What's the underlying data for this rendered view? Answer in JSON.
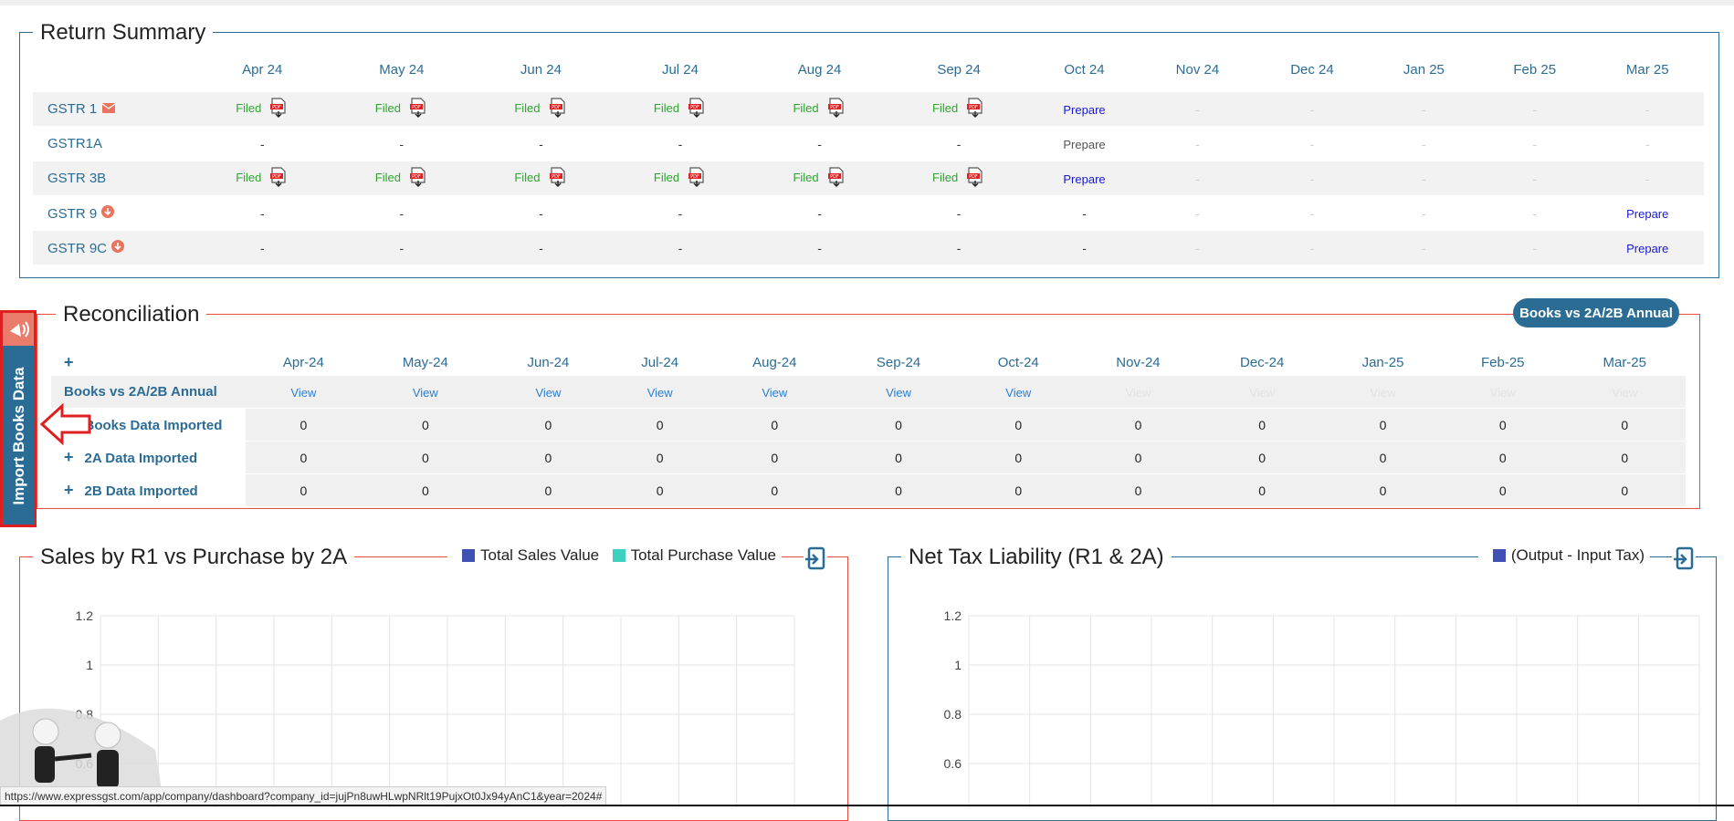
{
  "return_summary": {
    "title": "Return Summary",
    "months": [
      "Apr 24",
      "May 24",
      "Jun 24",
      "Jul 24",
      "Aug 24",
      "Sep 24",
      "Oct 24",
      "Nov 24",
      "Dec 24",
      "Jan 25",
      "Feb 25",
      "Mar 25"
    ],
    "rows": [
      {
        "name": "GSTR 1",
        "icon": "envelope-icon",
        "cells": [
          "Filed",
          "Filed",
          "Filed",
          "Filed",
          "Filed",
          "Filed",
          "Prepare",
          "-",
          "-",
          "-",
          "-",
          "-"
        ]
      },
      {
        "name": "GSTR1A",
        "icon": "",
        "cells": [
          "-",
          "-",
          "-",
          "-",
          "-",
          "-",
          "Prepare",
          "-",
          "-",
          "-",
          "-",
          "-"
        ]
      },
      {
        "name": "GSTR 3B",
        "icon": "",
        "cells": [
          "Filed",
          "Filed",
          "Filed",
          "Filed",
          "Filed",
          "Filed",
          "Prepare",
          "-",
          "-",
          "-",
          "-",
          "-"
        ]
      },
      {
        "name": "GSTR 9",
        "icon": "download-circle-icon",
        "cells": [
          "-",
          "-",
          "-",
          "-",
          "-",
          "-",
          "-",
          "-",
          "-",
          "-",
          "-",
          "Prepare"
        ]
      },
      {
        "name": "GSTR 9C",
        "icon": "download-circle-icon",
        "cells": [
          "-",
          "-",
          "-",
          "-",
          "-",
          "-",
          "-",
          "-",
          "-",
          "-",
          "-",
          "Prepare"
        ]
      }
    ]
  },
  "reconciliation": {
    "title": "Reconciliation",
    "button_label": "Books vs 2A/2B Annual",
    "plus": "+",
    "months": [
      "Apr-24",
      "May-24",
      "Jun-24",
      "Jul-24",
      "Aug-24",
      "Sep-24",
      "Oct-24",
      "Nov-24",
      "Dec-24",
      "Jan-25",
      "Feb-25",
      "Mar-25"
    ],
    "annual_row": {
      "name": "Books vs 2A/2B Annual",
      "cells": [
        "View",
        "View",
        "View",
        "View",
        "View",
        "View",
        "View",
        "View",
        "View",
        "View",
        "View",
        "View"
      ],
      "active_count": 7
    },
    "rows": [
      {
        "name": "Books Data Imported",
        "cells": [
          "0",
          "0",
          "0",
          "0",
          "0",
          "0",
          "0",
          "0",
          "0",
          "0",
          "0",
          "0"
        ]
      },
      {
        "name": "2A Data Imported",
        "cells": [
          "0",
          "0",
          "0",
          "0",
          "0",
          "0",
          "0",
          "0",
          "0",
          "0",
          "0",
          "0"
        ]
      },
      {
        "name": "2B Data Imported",
        "cells": [
          "0",
          "0",
          "0",
          "0",
          "0",
          "0",
          "0",
          "0",
          "0",
          "0",
          "0",
          "0"
        ]
      }
    ]
  },
  "side_tab": {
    "label": "Import Books Data"
  },
  "charts": [
    {
      "title": "Sales by R1 vs Purchase by 2A",
      "legend": [
        {
          "label": "Total Sales Value",
          "color": "#3f51b5"
        },
        {
          "label": "Total Purchase Value",
          "color": "#3fd1c0"
        }
      ],
      "y_ticks": [
        "1.2",
        "1",
        "0.8",
        "0.6"
      ]
    },
    {
      "title": "Net Tax Liability (R1 & 2A)",
      "legend": [
        {
          "label": "(Output - Input Tax)",
          "color": "#3f51b5"
        }
      ],
      "y_ticks": [
        "1.2",
        "1",
        "0.8",
        "0.6"
      ]
    }
  ],
  "status_url": "https://www.expressgst.com/app/company/dashboard?company_id=jujPn8uwHLwpNRlt19PujxOt0Jx94yAnC1&year=2024#",
  "colors": {
    "accent": "#2b6c95",
    "filed": "#2fa52f",
    "prepare": "#1a1ad6",
    "panel_red": "#e74c3c",
    "highlight": "#e02020"
  }
}
